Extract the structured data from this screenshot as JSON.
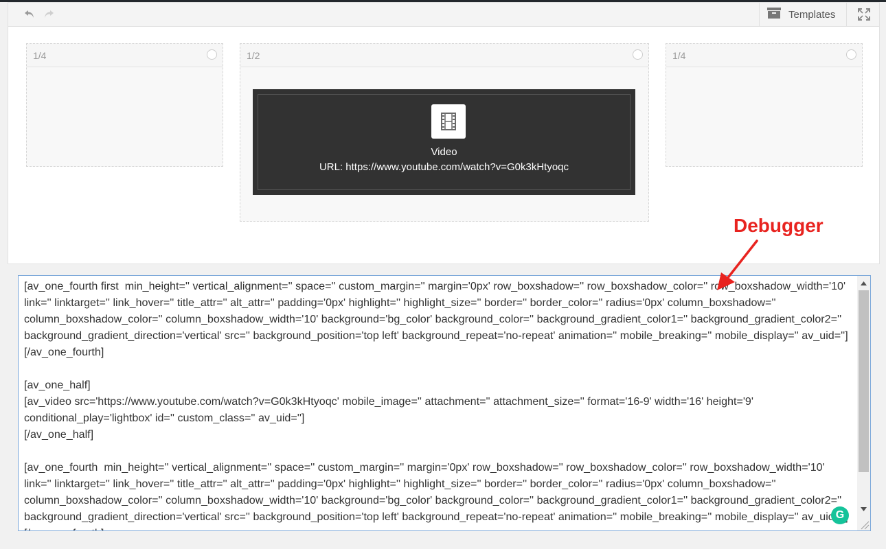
{
  "toolbar": {
    "undo_icon": "undo-icon",
    "redo_icon": "redo-icon",
    "templates_label": "Templates",
    "templates_icon": "archive-box-icon",
    "fullscreen_icon": "expand-icon"
  },
  "canvas": {
    "columns": [
      {
        "label": "1/4"
      },
      {
        "label": "1/2"
      },
      {
        "label": "1/4"
      }
    ],
    "video": {
      "icon": "film-icon",
      "title": "Video",
      "url_text": "URL: https://www.youtube.com/watch?v=G0k3kHtyoqc"
    }
  },
  "debugger": {
    "text": "[av_one_fourth first  min_height='' vertical_alignment='' space='' custom_margin='' margin='0px' row_boxshadow='' row_boxshadow_color='' row_boxshadow_width='10' link='' linktarget='' link_hover='' title_attr='' alt_attr='' padding='0px' highlight='' highlight_size='' border='' border_color='' radius='0px' column_boxshadow='' column_boxshadow_color='' column_boxshadow_width='10' background='bg_color' background_color='' background_gradient_color1='' background_gradient_color2='' background_gradient_direction='vertical' src='' background_position='top left' background_repeat='no-repeat' animation='' mobile_breaking='' mobile_display='' av_uid=''][/av_one_fourth]\n\n[av_one_half]\n[av_video src='https://www.youtube.com/watch?v=G0k3kHtyoqc' mobile_image='' attachment='' attachment_size='' format='16-9' width='16' height='9' conditional_play='lightbox' id='' custom_class='' av_uid='']\n[/av_one_half]\n\n[av_one_fourth  min_height='' vertical_alignment='' space='' custom_margin='' margin='0px' row_boxshadow='' row_boxshadow_color='' row_boxshadow_width='10' link='' linktarget='' link_hover='' title_attr='' alt_attr='' padding='0px' highlight='' highlight_size='' border='' border_color='' radius='0px' column_boxshadow='' column_boxshadow_color='' column_boxshadow_width='10' background='bg_color' background_color='' background_gradient_color1='' background_gradient_color2='' background_gradient_direction='vertical' src='' background_position='top left' background_repeat='no-repeat' animation='' mobile_breaking='' mobile_display='' av_uid=''][/av_one_fourth]",
    "grammarly_letter": "G"
  },
  "annotation": {
    "label": "Debugger",
    "color": "#e8231f"
  }
}
